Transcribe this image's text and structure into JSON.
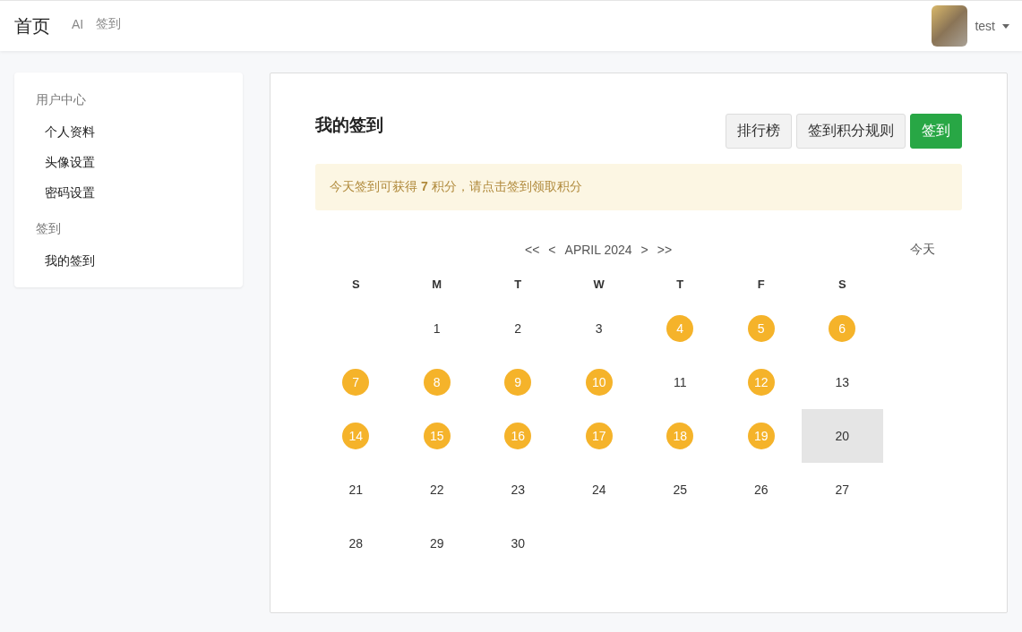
{
  "navbar": {
    "brand": "首页",
    "links": [
      {
        "label": "AI"
      },
      {
        "label": "签到"
      }
    ],
    "user": {
      "name": "test"
    }
  },
  "sidebar": {
    "groups": [
      {
        "title": "用户中心",
        "items": [
          {
            "label": "个人资料"
          },
          {
            "label": "头像设置"
          },
          {
            "label": "密码设置"
          }
        ]
      },
      {
        "title": "签到",
        "items": [
          {
            "label": "我的签到"
          }
        ]
      }
    ]
  },
  "main": {
    "title": "我的签到",
    "buttons": [
      {
        "label": "排行榜",
        "kind": "default"
      },
      {
        "label": "签到积分规则",
        "kind": "default"
      },
      {
        "label": "签到",
        "kind": "primary"
      }
    ],
    "notice": "今天签到可获得 **7** 积分，请点击签到领取积分",
    "calendar": {
      "nav": [
        "<<",
        "<"
      ],
      "month": "APRIL 2024",
      "nav_after": [
        ">",
        ">>"
      ],
      "today_button": "今天",
      "weekdays": [
        "S",
        "M",
        "T",
        "W",
        "T",
        "F",
        "S"
      ],
      "weeks": [
        [
          {
            "day": "1",
            "checked": false,
            "today": false
          },
          {
            "day": "2",
            "checked": false,
            "today": false
          },
          {
            "day": "3",
            "checked": false,
            "today": false
          },
          {
            "day": "4",
            "checked": true,
            "today": false
          },
          {
            "day": "5",
            "checked": true,
            "today": false
          },
          {
            "day": "6",
            "checked": true,
            "today": false
          }
        ],
        [
          {
            "day": "7",
            "checked": true,
            "today": false
          },
          {
            "day": "8",
            "checked": true,
            "today": false
          },
          {
            "day": "9",
            "checked": true,
            "today": false
          },
          {
            "day": "10",
            "checked": true,
            "today": false
          },
          {
            "day": "11",
            "checked": false,
            "today": false
          },
          {
            "day": "12",
            "checked": true,
            "today": false
          },
          {
            "day": "13",
            "checked": false,
            "today": false
          }
        ],
        [
          {
            "day": "14",
            "checked": true,
            "today": false
          },
          {
            "day": "15",
            "checked": true,
            "today": false
          },
          {
            "day": "16",
            "checked": true,
            "today": false
          },
          {
            "day": "17",
            "checked": true,
            "today": false
          },
          {
            "day": "18",
            "checked": true,
            "today": false
          },
          {
            "day": "19",
            "checked": true,
            "today": false
          },
          {
            "day": "20",
            "checked": false,
            "today": true
          }
        ],
        [
          {
            "day": "21",
            "checked": false,
            "today": false
          },
          {
            "day": "22",
            "checked": false,
            "today": false
          },
          {
            "day": "23",
            "checked": false,
            "today": false
          },
          {
            "day": "24",
            "checked": false,
            "today": false
          },
          {
            "day": "25",
            "checked": false,
            "today": false
          },
          {
            "day": "26",
            "checked": false,
            "today": false
          },
          {
            "day": "27",
            "checked": false,
            "today": false
          }
        ],
        [
          {
            "day": "28",
            "checked": false,
            "today": false
          },
          {
            "day": "29",
            "checked": false,
            "today": false
          },
          {
            "day": "30",
            "checked": false,
            "today": false
          }
        ]
      ]
    }
  }
}
